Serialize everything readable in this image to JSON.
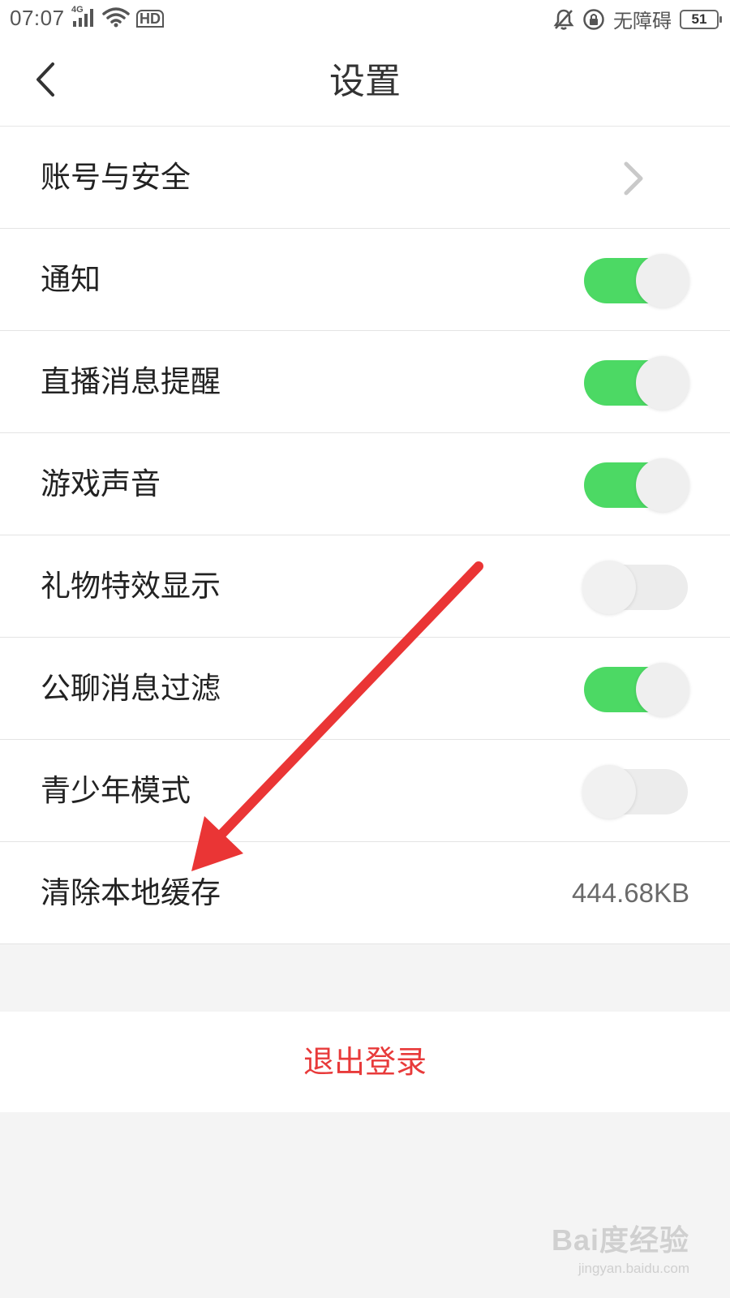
{
  "status_bar": {
    "time": "07:07",
    "network": "4G",
    "hd_badge": "HD",
    "accessibility_text": "无障碍",
    "battery": "51"
  },
  "header": {
    "title": "设置",
    "back_icon": "chevron-left-icon"
  },
  "settings": [
    {
      "label": "账号与安全",
      "type": "link",
      "icon": "chevron-right-icon"
    },
    {
      "label": "通知",
      "type": "toggle",
      "on": true
    },
    {
      "label": "直播消息提醒",
      "type": "toggle",
      "on": true
    },
    {
      "label": "游戏声音",
      "type": "toggle",
      "on": true
    },
    {
      "label": "礼物特效显示",
      "type": "toggle",
      "on": false
    },
    {
      "label": "公聊消息过滤",
      "type": "toggle",
      "on": true
    },
    {
      "label": "青少年模式",
      "type": "toggle",
      "on": false
    },
    {
      "label": "清除本地缓存",
      "type": "value",
      "value": "444.68KB"
    }
  ],
  "logout": {
    "label": "退出登录"
  },
  "colors": {
    "toggle_on": "#4cd964",
    "toggle_off": "#ececec",
    "logout_text": "#e83a3a",
    "annotation_arrow": "#ea3535"
  },
  "watermark": {
    "main": "Bai度经验",
    "sub": "jingyan.baidu.com"
  }
}
